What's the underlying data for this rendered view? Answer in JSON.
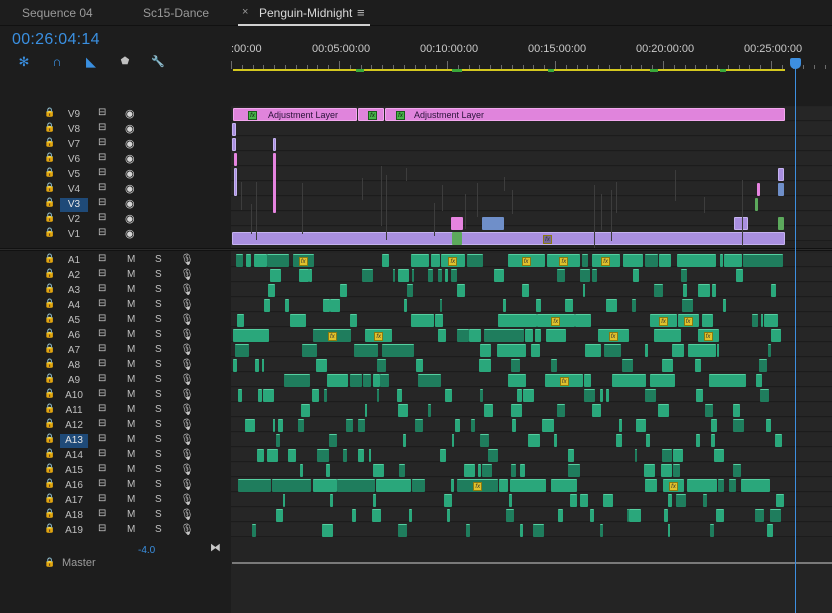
{
  "tabs": [
    {
      "label": "Sequence 04"
    },
    {
      "label": "Sc15-Dance"
    },
    {
      "label": "Penguin-Midnight",
      "active": true
    }
  ],
  "tab_close_glyph": "×",
  "tab_menu_glyph": "≡",
  "timecode": "00:26:04:14",
  "toolbar": {
    "tools": [
      {
        "name": "snap-icon",
        "glyph": "✻",
        "color": "#3a8fe0"
      },
      {
        "name": "link-icon",
        "glyph": "∩",
        "color": "#3a8fe0"
      },
      {
        "name": "linked-selection-icon",
        "glyph": "◣",
        "color": "#3a8fe0"
      },
      {
        "name": "marker-icon",
        "glyph": "⬟",
        "color": "#c0c0c0"
      },
      {
        "name": "settings-wrench-icon",
        "glyph": "🔧",
        "color": "#c0c0c0"
      }
    ]
  },
  "ruler": {
    "labels": [
      ":00:00",
      "00:05:00:00",
      "00:10:00:00",
      "00:15:00:00",
      "00:20:00:00",
      "00:25:00:00"
    ]
  },
  "video_tracks": [
    {
      "name": "V9"
    },
    {
      "name": "V8"
    },
    {
      "name": "V7"
    },
    {
      "name": "V6"
    },
    {
      "name": "V5"
    },
    {
      "name": "V4"
    },
    {
      "name": "V3",
      "selected": true
    },
    {
      "name": "V2"
    },
    {
      "name": "V1"
    }
  ],
  "audio_tracks": [
    {
      "name": "A1"
    },
    {
      "name": "A2"
    },
    {
      "name": "A3"
    },
    {
      "name": "A4"
    },
    {
      "name": "A5"
    },
    {
      "name": "A6"
    },
    {
      "name": "A7"
    },
    {
      "name": "A8"
    },
    {
      "name": "A9"
    },
    {
      "name": "A10"
    },
    {
      "name": "A11"
    },
    {
      "name": "A12"
    },
    {
      "name": "A13",
      "selected": true
    },
    {
      "name": "A14"
    },
    {
      "name": "A15"
    },
    {
      "name": "A16"
    },
    {
      "name": "A17"
    },
    {
      "name": "A18"
    },
    {
      "name": "A19"
    }
  ],
  "track_toggles": {
    "mute": "M",
    "solo": "S"
  },
  "icons": {
    "lock": "🔒",
    "sync": "⊟",
    "eye": "◉",
    "mic": "🎙"
  },
  "clips": {
    "adjustment_label": "Adjustment Layer",
    "fx_label": "fx"
  },
  "master": {
    "label": "Master",
    "volume": "-4.0",
    "end_icon": "⧓"
  },
  "colors": {
    "accent": "#3a8fe0",
    "adjustment": "#e084dc",
    "video": "#a98fe0",
    "audio": "#2aa77b",
    "workbar": "#d4c81f"
  }
}
